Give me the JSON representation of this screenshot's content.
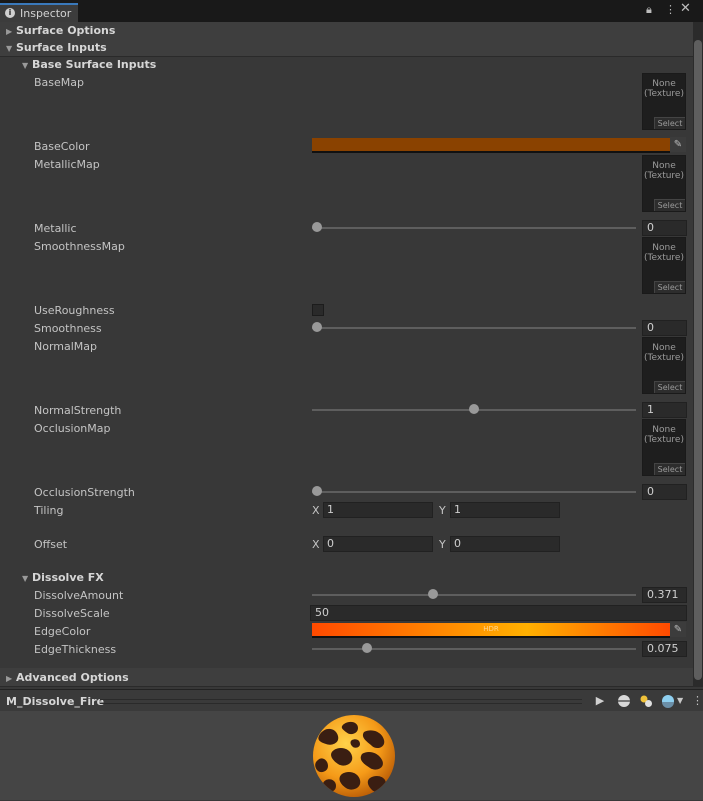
{
  "tab": {
    "label": "Inspector",
    "icon": "info-icon"
  },
  "window_icons": [
    "lock-icon",
    "more-vert-icon",
    "close-icon"
  ],
  "sections": {
    "surface_options": "Surface Options",
    "surface_inputs": "Surface Inputs",
    "base_surface_inputs": "Base Surface Inputs",
    "dissolve_fx": "Dissolve FX",
    "advanced_options": "Advanced Options"
  },
  "texture_field": {
    "none": "None",
    "type": "(Texture)",
    "select": "Select"
  },
  "props": {
    "basemap": "BaseMap",
    "basecolor": "BaseColor",
    "metallicmap": "MetallicMap",
    "metallic": "Metallic",
    "smoothnessmap": "SmoothnessMap",
    "useroughness": "UseRoughness",
    "smoothness": "Smoothness",
    "normalmap": "NormalMap",
    "normalstrength": "NormalStrength",
    "occlusionmap": "OcclusionMap",
    "occlusionstrength": "OcclusionStrength",
    "tiling": "Tiling",
    "offset": "Offset",
    "dissolveamount": "DissolveAmount",
    "dissolvescale": "DissolveScale",
    "edgecolor": "EdgeColor",
    "edgethickness": "EdgeThickness"
  },
  "values": {
    "metallic": "0",
    "smoothness": "0",
    "normalstrength": "1",
    "occlusionstrength": "0",
    "tiling_x": "1",
    "tiling_y": "1",
    "offset_x": "0",
    "offset_y": "0",
    "dissolveamount": "0.371",
    "dissolvescale": "50",
    "edgethickness": "0.075"
  },
  "vector_labels": {
    "x": "X",
    "y": "Y"
  },
  "slider_fractions": {
    "metallic": 0,
    "smoothness": 0,
    "normalstrength": 0.5,
    "occlusionstrength": 0,
    "dissolveamount": 0.371,
    "edgethickness": 0.16
  },
  "colors": {
    "basecolor": "#8a4200",
    "edgecolor_start": "#ff4a00",
    "edgecolor_end": "#ffb000",
    "accent": "#3a79bb"
  },
  "edgecolor_badge": "HDR",
  "preview": {
    "title": "M_Dissolve_Fire",
    "icons": [
      "play-icon",
      "sphere-shape-icon",
      "light-icon",
      "skybox-icon",
      "dropdown-icon"
    ]
  }
}
